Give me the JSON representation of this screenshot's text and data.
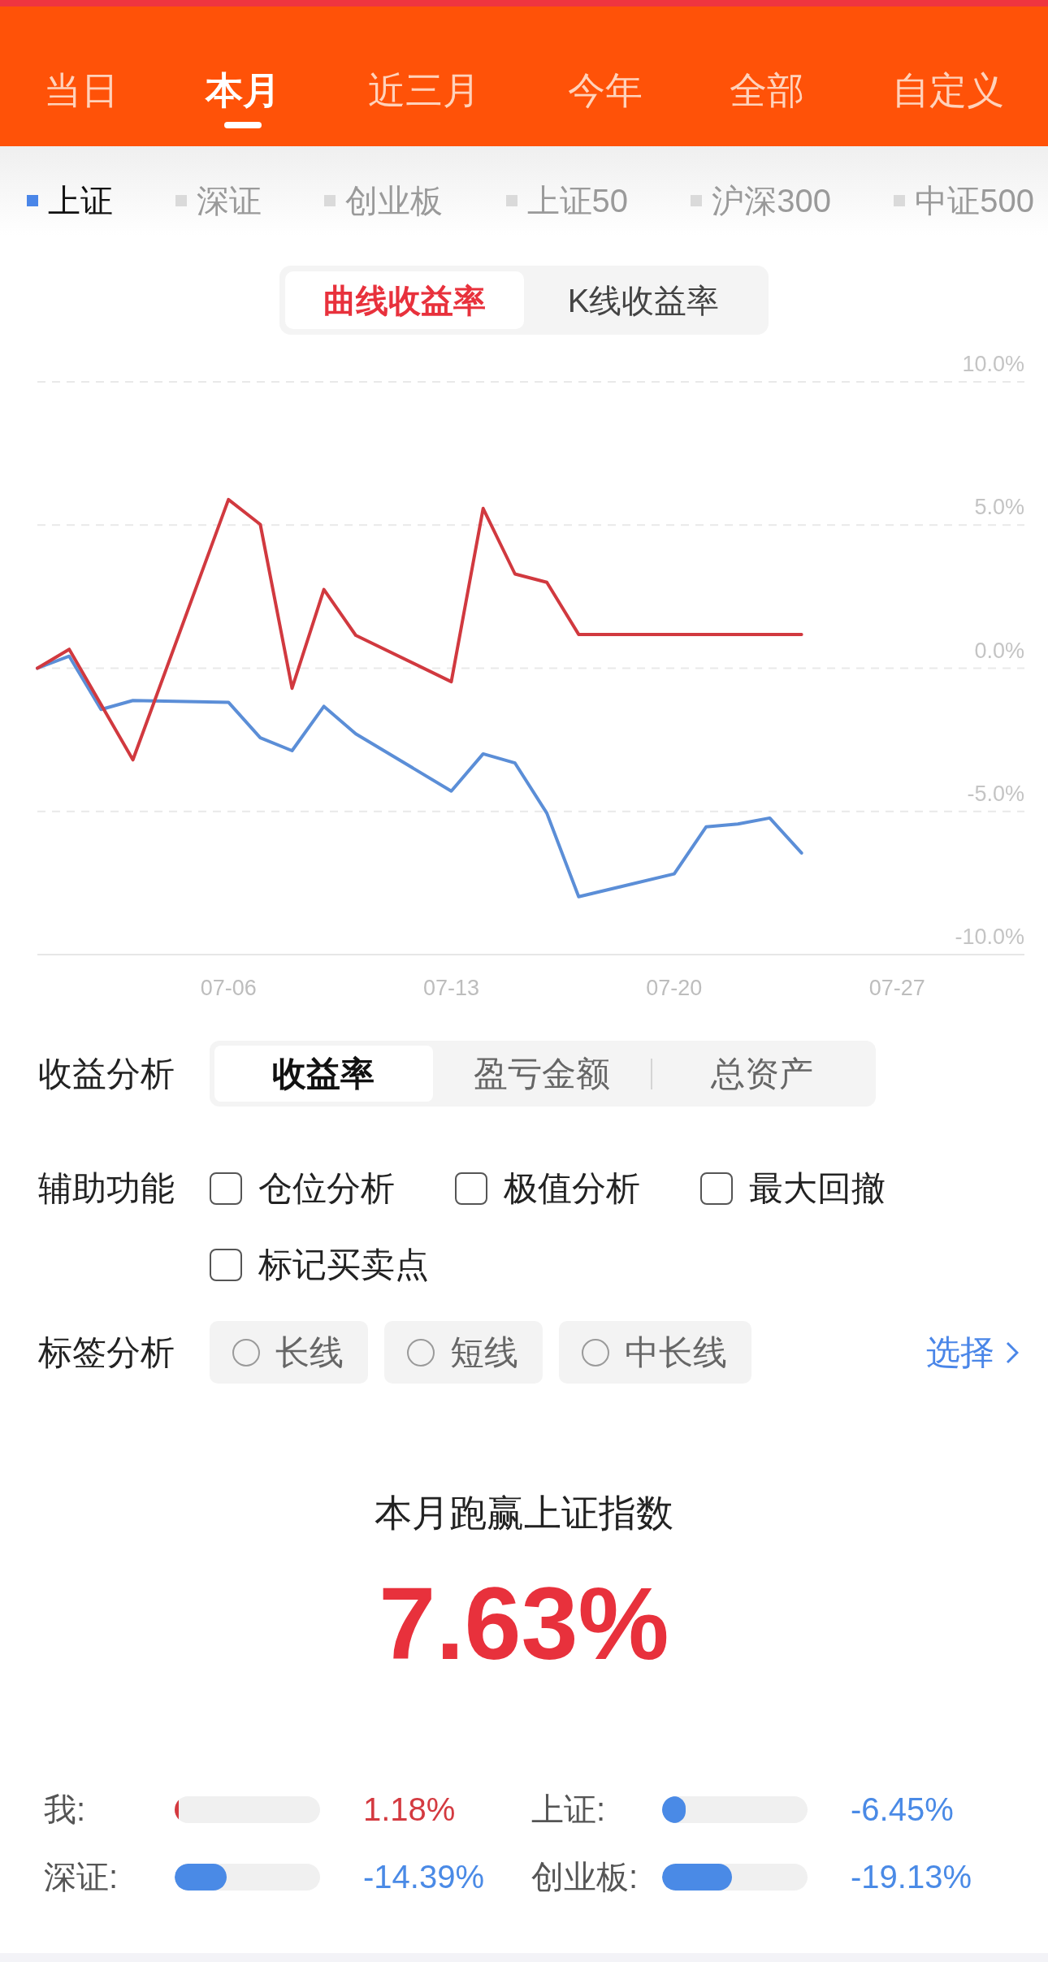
{
  "period_tabs": [
    {
      "label": "当日",
      "selected": false
    },
    {
      "label": "本月",
      "selected": true
    },
    {
      "label": "近三月",
      "selected": false
    },
    {
      "label": "今年",
      "selected": false
    },
    {
      "label": "全部",
      "selected": false
    },
    {
      "label": "自定义",
      "selected": false
    }
  ],
  "index_tabs": [
    {
      "label": "上证",
      "selected": true
    },
    {
      "label": "深证",
      "selected": false
    },
    {
      "label": "创业板",
      "selected": false
    },
    {
      "label": "上证50",
      "selected": false
    },
    {
      "label": "沪深300",
      "selected": false
    },
    {
      "label": "中证500",
      "selected": false
    }
  ],
  "chart_mode_tabs": [
    {
      "label": "曲线收益率",
      "selected": true
    },
    {
      "label": "K线收益率",
      "selected": false
    }
  ],
  "chart": {
    "chart_data": {
      "type": "line",
      "grid": true,
      "categories": [
        null,
        null,
        null,
        null,
        null,
        null,
        "07-06",
        null,
        null,
        null,
        null,
        null,
        null,
        "07-13",
        null,
        null,
        null,
        null,
        null,
        null,
        "07-20",
        null,
        null,
        null,
        null,
        null,
        null,
        "07-27",
        null,
        null,
        null,
        null
      ],
      "ylim": [
        -10,
        10
      ],
      "yticks": [
        {
          "value": 10,
          "label": "10.0%"
        },
        {
          "value": 5,
          "label": "5.0%"
        },
        {
          "value": 0,
          "label": "0.0%"
        },
        {
          "value": -5,
          "label": "-5.0%"
        },
        {
          "value": -10,
          "label": "-10.0%"
        }
      ],
      "series": [
        {
          "color": "#d1393f",
          "values": [
            0,
            0.66,
            -1.27,
            -3.2,
            null,
            null,
            5.89,
            5.02,
            -0.7,
            2.75,
            1.15,
            null,
            null,
            -0.47,
            5.58,
            3.29,
            3.0,
            1.18,
            null,
            null,
            1.18,
            1.18,
            1.18,
            1.18,
            1.18,
            null,
            null,
            null,
            null,
            null,
            null,
            null
          ]
        },
        {
          "color": "#5b8ed7",
          "values": [
            0,
            0.42,
            -1.44,
            -1.13,
            null,
            null,
            -1.19,
            -2.43,
            -2.88,
            -1.33,
            -2.29,
            null,
            null,
            -4.29,
            -2.99,
            -3.31,
            -5.06,
            -7.98,
            null,
            null,
            -7.18,
            -5.54,
            -5.44,
            -5.23,
            -6.45,
            null,
            null,
            null,
            null,
            null,
            null,
            null
          ]
        }
      ]
    }
  },
  "return_analysis": {
    "label": "收益分析",
    "tabs": [
      {
        "label": "收益率",
        "selected": true
      },
      {
        "label": "盈亏金额",
        "selected": false
      },
      {
        "label": "总资产",
        "selected": false
      }
    ]
  },
  "auxiliary": {
    "label": "辅助功能",
    "options": [
      {
        "label": "仓位分析",
        "checked": false
      },
      {
        "label": "极值分析",
        "checked": false
      },
      {
        "label": "最大回撤",
        "checked": false
      },
      {
        "label": "标记买卖点",
        "checked": false
      }
    ]
  },
  "tag_analysis": {
    "label": "标签分析",
    "options": [
      {
        "label": "长线",
        "selected": false
      },
      {
        "label": "短线",
        "selected": false
      },
      {
        "label": "中长线",
        "selected": false
      }
    ],
    "action": "选择"
  },
  "summary": {
    "title": "本月跑赢上证指数",
    "value": "7.63%"
  },
  "comparison": [
    {
      "label": "我:",
      "level": 0.03,
      "value": "1.18%",
      "color": "#d43a40"
    },
    {
      "label": "上证:",
      "level": 0.16,
      "value": "-6.45%",
      "color": "#4a8ae6"
    },
    {
      "label": "深证:",
      "level": 0.36,
      "value": "-14.39%",
      "color": "#4a8ae6"
    },
    {
      "label": "创业板:",
      "level": 0.48,
      "value": "-19.13%",
      "color": "#4a8ae6"
    }
  ]
}
